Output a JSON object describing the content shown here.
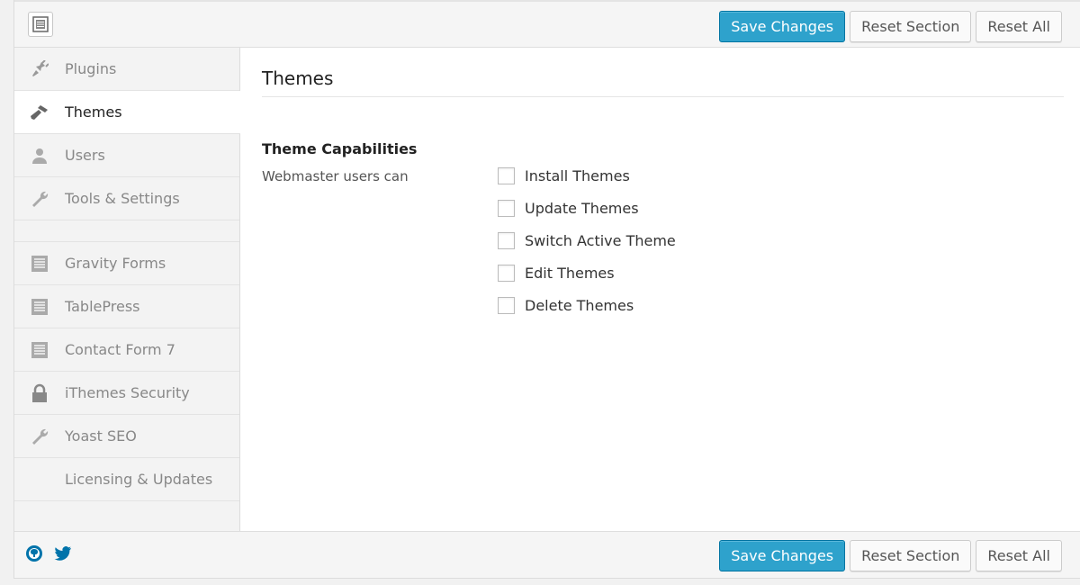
{
  "toolbar": {
    "save_label": "Save Changes",
    "reset_section_label": "Reset Section",
    "reset_all_label": "Reset All"
  },
  "sidebar": {
    "items_top": [
      {
        "label": "Plugins",
        "icon": "plug-icon"
      },
      {
        "label": "Themes",
        "icon": "brush-icon",
        "active": true
      },
      {
        "label": "Users",
        "icon": "user-icon"
      },
      {
        "label": "Tools & Settings",
        "icon": "wrench-icon"
      }
    ],
    "items_bottom": [
      {
        "label": "Gravity Forms",
        "icon": "list-icon"
      },
      {
        "label": "TablePress",
        "icon": "list-icon"
      },
      {
        "label": "Contact Form 7",
        "icon": "list-icon"
      },
      {
        "label": "iThemes Security",
        "icon": "lock-icon"
      },
      {
        "label": "Yoast SEO",
        "icon": "wrench-icon"
      },
      {
        "label": "Licensing & Updates",
        "icon": ""
      }
    ]
  },
  "main": {
    "title": "Themes",
    "section_title": "Theme Capabilities",
    "section_desc": "Webmaster users can",
    "options": [
      {
        "label": "Install Themes",
        "checked": false
      },
      {
        "label": "Update Themes",
        "checked": false
      },
      {
        "label": "Switch Active Theme",
        "checked": false
      },
      {
        "label": "Edit Themes",
        "checked": false
      },
      {
        "label": "Delete Themes",
        "checked": false
      }
    ]
  },
  "footer": {
    "icons": [
      "github-icon",
      "twitter-icon"
    ]
  },
  "colors": {
    "accent": "#2ea2cc",
    "twitter": "#0073aa"
  }
}
